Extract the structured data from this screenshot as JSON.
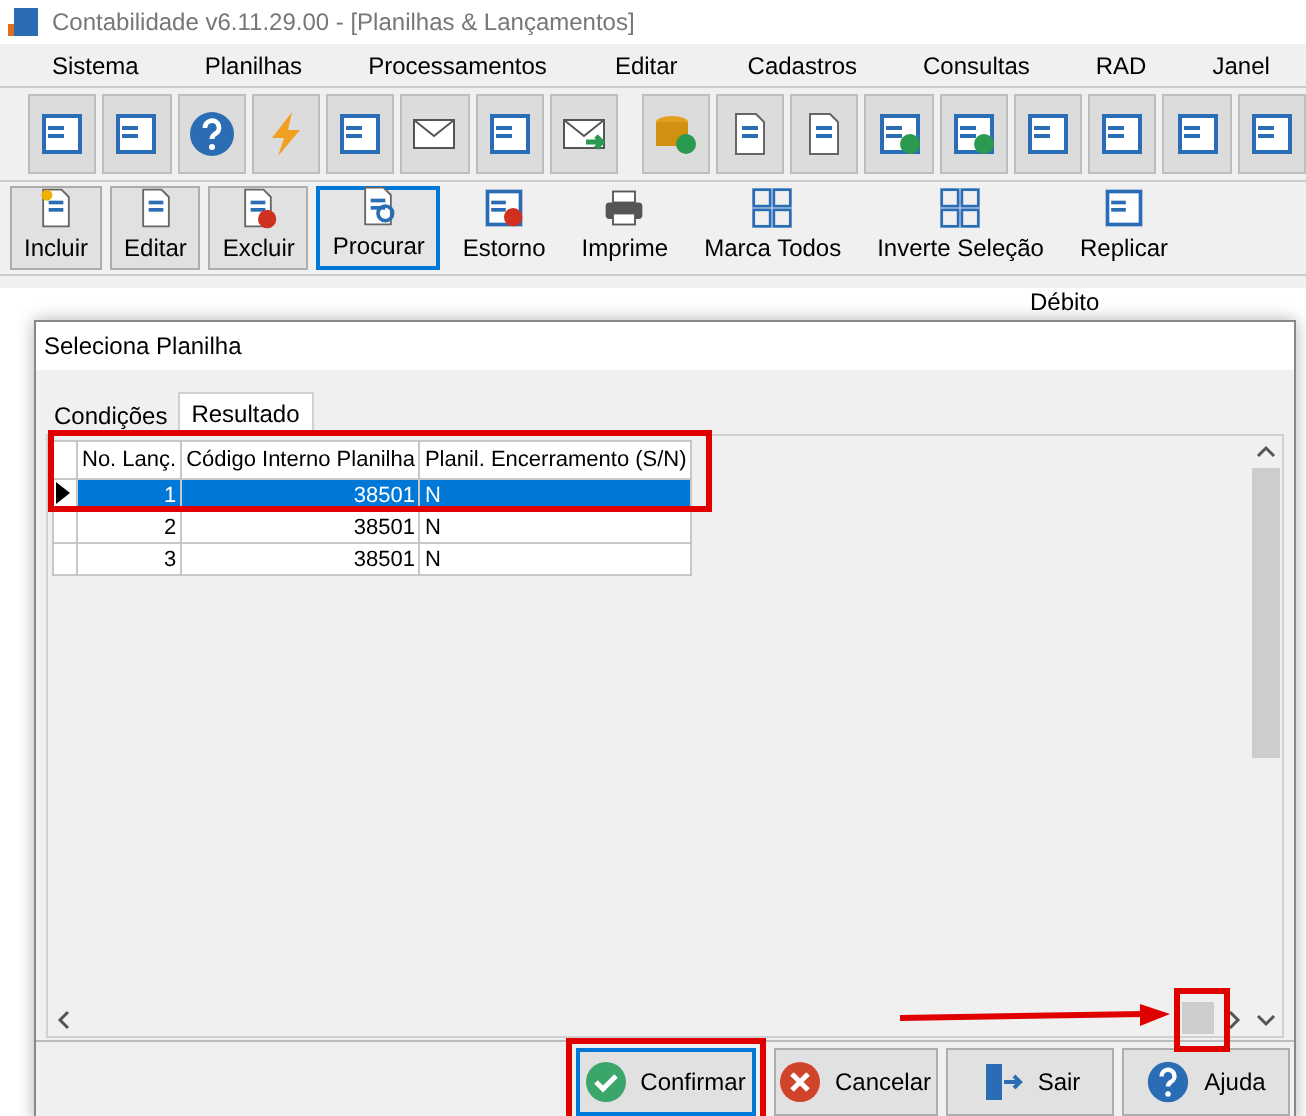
{
  "window": {
    "title": "Contabilidade v6.11.29.00 - [Planilhas & Lançamentos]"
  },
  "menu": [
    "Sistema",
    "Planilhas",
    "Processamentos",
    "Editar",
    "Cadastros",
    "Consultas",
    "RAD",
    "Janel"
  ],
  "actions": [
    {
      "label": "Incluir",
      "selected": false
    },
    {
      "label": "Editar",
      "selected": false
    },
    {
      "label": "Excluir",
      "selected": false
    },
    {
      "label": "Procurar",
      "selected": true
    },
    {
      "label": "Estorno",
      "selected": false
    },
    {
      "label": "Imprime",
      "selected": false
    },
    {
      "label": "Marca Todos",
      "selected": false
    },
    {
      "label": "Inverte Seleção",
      "selected": false
    },
    {
      "label": "Replicar",
      "selected": false
    }
  ],
  "background": {
    "column_header": "Débito"
  },
  "dialog": {
    "title": "Seleciona Planilha",
    "tabs": [
      {
        "label": "Condições",
        "selected": false
      },
      {
        "label": "Resultado",
        "selected": true
      }
    ],
    "table": {
      "columns": [
        "No. Lanç.",
        "Código Interno Planilha",
        "Planil. Encerramento (S/N)"
      ],
      "rows": [
        {
          "cells": [
            "1",
            "38501",
            "N"
          ],
          "selected": true
        },
        {
          "cells": [
            "2",
            "38501",
            "N"
          ],
          "selected": false
        },
        {
          "cells": [
            "3",
            "38501",
            "N"
          ],
          "selected": false
        }
      ]
    },
    "buttons": [
      {
        "label": "Confirmar",
        "kind": "confirm",
        "focused": true
      },
      {
        "label": "Cancelar",
        "kind": "cancel",
        "focused": false
      },
      {
        "label": "Sair",
        "kind": "exit",
        "focused": false
      },
      {
        "label": "Ajuda",
        "kind": "help",
        "focused": false
      }
    ]
  }
}
